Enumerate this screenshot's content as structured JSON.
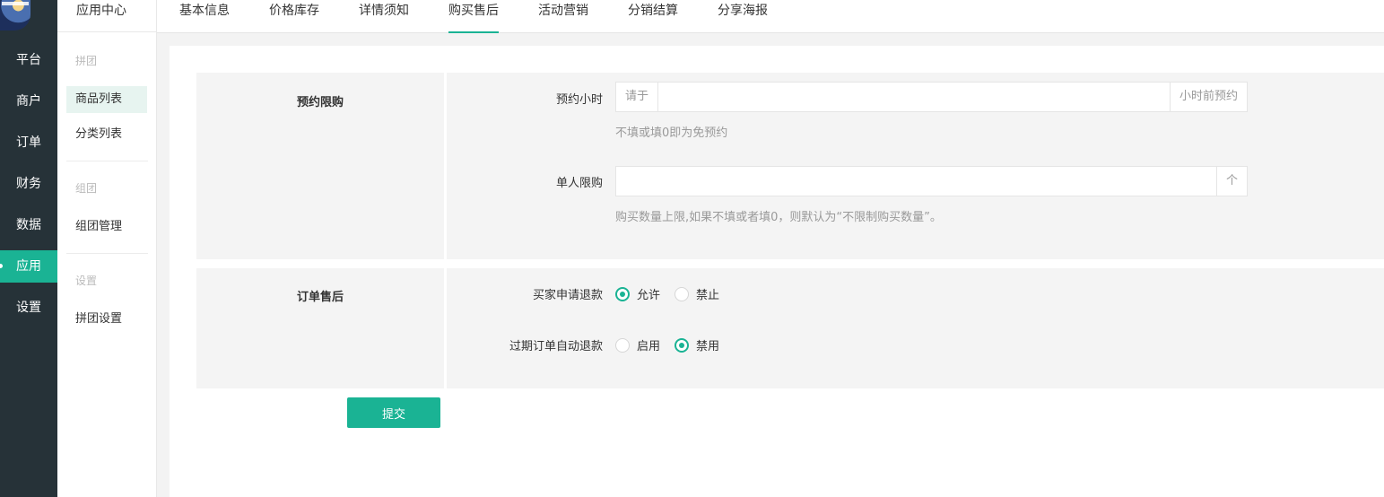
{
  "main_nav": {
    "items": [
      {
        "label": "平台"
      },
      {
        "label": "商户"
      },
      {
        "label": "订单"
      },
      {
        "label": "财务"
      },
      {
        "label": "数据"
      },
      {
        "label": "应用",
        "active": true
      },
      {
        "label": "设置"
      }
    ]
  },
  "sub_nav": {
    "title": "应用中心",
    "groups": [
      {
        "label": "拼团",
        "items": [
          {
            "label": "商品列表",
            "active": true
          },
          {
            "label": "分类列表"
          }
        ]
      },
      {
        "label": "组团",
        "items": [
          {
            "label": "组团管理"
          }
        ]
      },
      {
        "label": "设置",
        "items": [
          {
            "label": "拼团设置"
          }
        ]
      }
    ]
  },
  "tabs": [
    {
      "label": "基本信息"
    },
    {
      "label": "价格库存"
    },
    {
      "label": "详情须知"
    },
    {
      "label": "购买售后",
      "active": true
    },
    {
      "label": "活动营销"
    },
    {
      "label": "分销结算"
    },
    {
      "label": "分享海报"
    }
  ],
  "form": {
    "purchase_limit": {
      "title": "预约限购",
      "reserve_hours": {
        "label": "预约小时",
        "prefix": "请于",
        "suffix": "小时前预约",
        "value": "",
        "help": "不填或填0即为免预约"
      },
      "per_person_limit": {
        "label": "单人限购",
        "suffix": "个",
        "value": "",
        "help": "购买数量上限,如果不填或者填0，则默认为“不限制购买数量”。"
      }
    },
    "after_sale": {
      "title": "订单售后",
      "refund_request": {
        "label": "买家申请退款",
        "options": [
          "允许",
          "禁止"
        ],
        "selected": "允许"
      },
      "auto_refund": {
        "label": "过期订单自动退款",
        "options": [
          "启用",
          "禁用"
        ],
        "selected": "禁用"
      }
    },
    "submit_label": "提交"
  },
  "colors": {
    "sidebar_bg": "#263238",
    "accent": "#1ab394",
    "section_bg": "#f4f4f4"
  }
}
